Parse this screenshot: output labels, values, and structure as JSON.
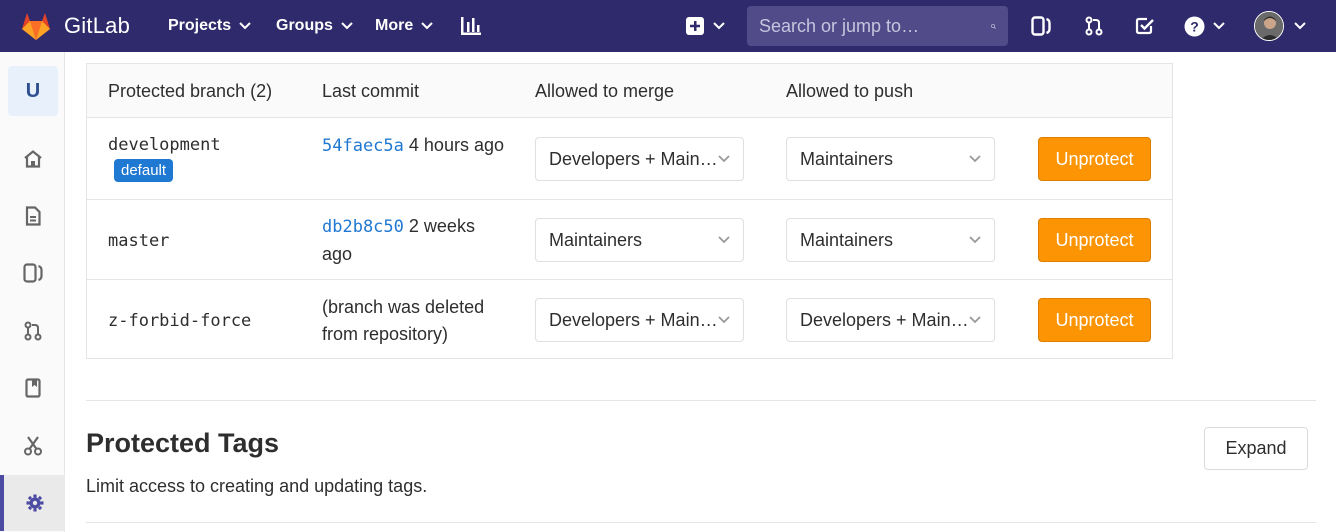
{
  "navbar": {
    "brand": "GitLab",
    "menu": [
      {
        "label": "Projects"
      },
      {
        "label": "Groups"
      },
      {
        "label": "More"
      }
    ],
    "search_placeholder": "Search or jump to…",
    "icons": [
      "plus-square-icon",
      "issues-icon",
      "merge-request-icon",
      "todo-check-icon",
      "help-icon",
      "avatar"
    ]
  },
  "sidebar": {
    "project_initial": "U",
    "items": [
      "home-icon",
      "repository-icon",
      "issues-icon",
      "merge-request-icon",
      "wiki-icon",
      "snippets-icon",
      "settings-icon"
    ]
  },
  "table": {
    "headers": {
      "branch": "Protected branch (2)",
      "commit": "Last commit",
      "merge": "Allowed to merge",
      "push": "Allowed to push"
    },
    "rows": [
      {
        "branch": "development",
        "badge": "default",
        "sha": "54faec5a",
        "commit_time": "4 hours ago",
        "merge": "Developers + Maintainers",
        "push": "Maintainers",
        "action": "Unprotect"
      },
      {
        "branch": "master",
        "sha": "db2b8c50",
        "commit_time": "2 weeks ago",
        "merge": "Maintainers",
        "push": "Maintainers",
        "action": "Unprotect"
      },
      {
        "branch": "z-forbid-force",
        "commit_note": "(branch was deleted from repository)",
        "merge": "Developers + Maintainers",
        "push": "Developers + Maintainers",
        "action": "Unprotect"
      }
    ]
  },
  "protected_tags": {
    "title": "Protected Tags",
    "description": "Limit access to creating and updating tags.",
    "expand_label": "Expand"
  },
  "colors": {
    "navbar": "#2f2a6b",
    "link": "#1f78d1",
    "warning_button": "#fc9403"
  }
}
